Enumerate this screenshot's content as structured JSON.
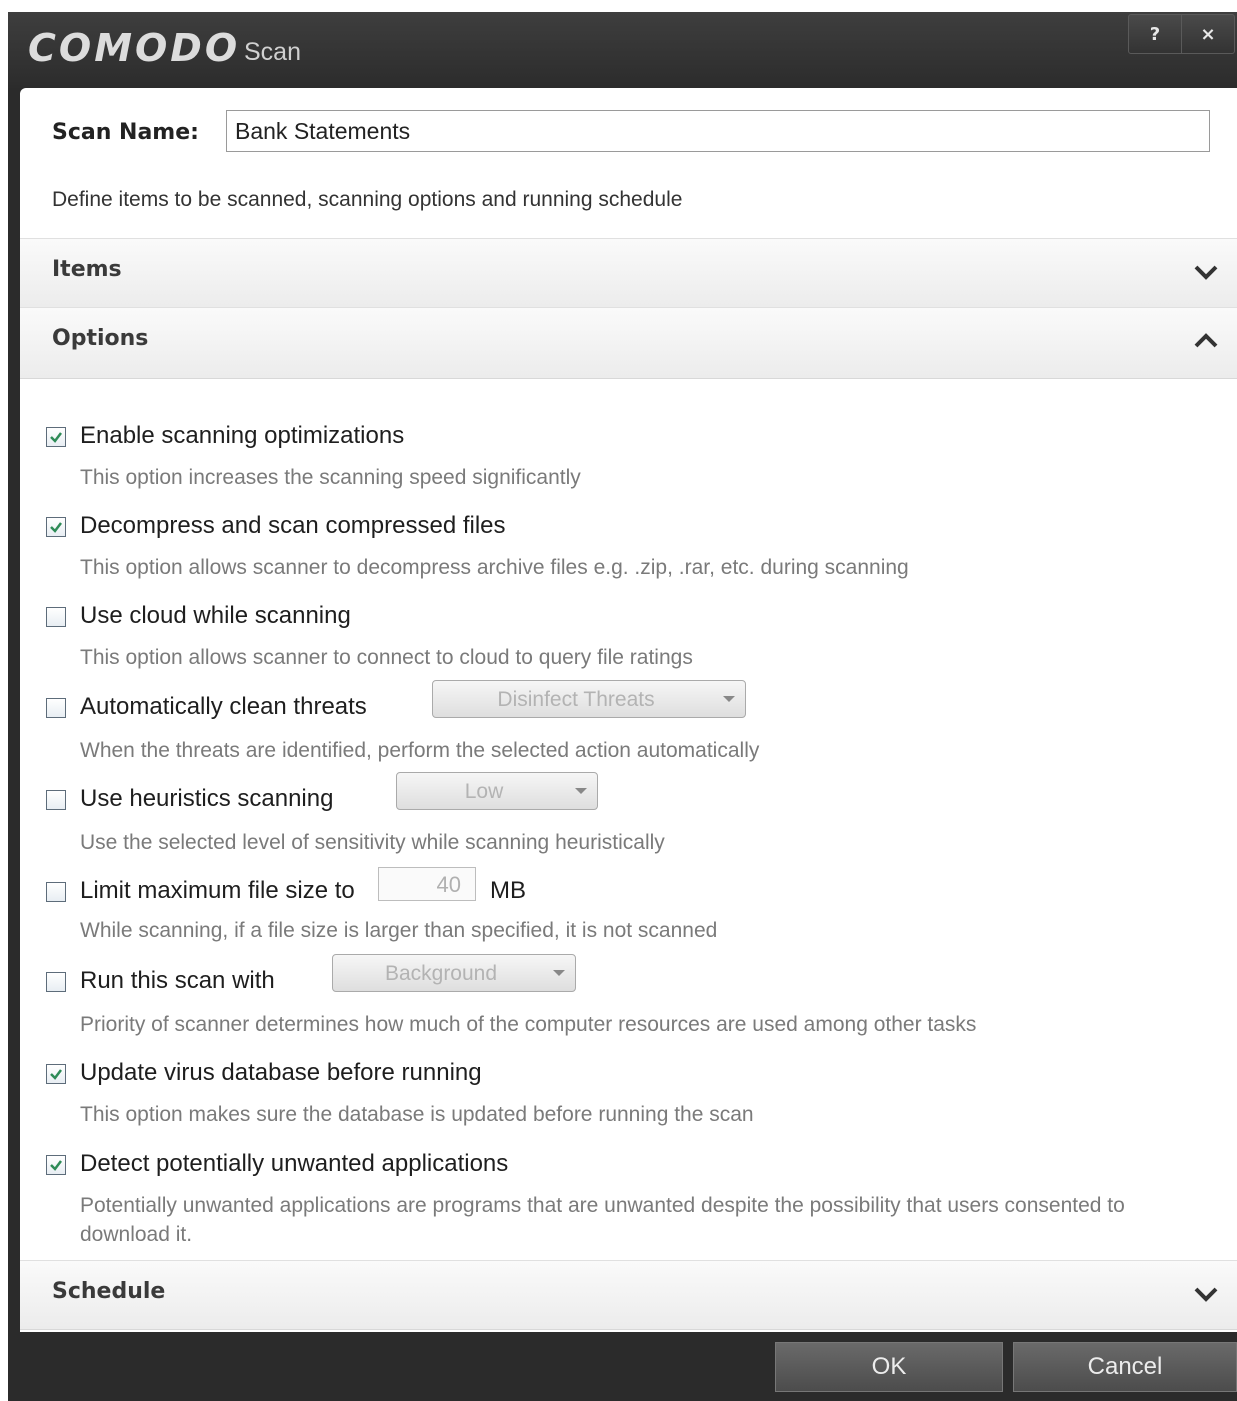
{
  "window": {
    "brand": "COMODO",
    "title": "Scan",
    "help_label": "?",
    "close_label": "×"
  },
  "scan_name": {
    "label": "Scan Name:",
    "value": "Bank Statements"
  },
  "intro": "Define items to be scanned, scanning options and running schedule",
  "sections": {
    "items": {
      "title": "Items",
      "state": "collapsed"
    },
    "options": {
      "title": "Options",
      "state": "expanded"
    },
    "schedule": {
      "title": "Schedule",
      "state": "collapsed"
    }
  },
  "options": [
    {
      "label": "Enable scanning optimizations",
      "checked": true,
      "description": "This option increases the scanning speed significantly"
    },
    {
      "label": "Decompress and scan compressed files",
      "checked": true,
      "description": "This option allows scanner to decompress archive files e.g. .zip, .rar, etc. during scanning"
    },
    {
      "label": "Use cloud while scanning",
      "checked": false,
      "description": "This option allows scanner to connect to cloud to query file ratings"
    },
    {
      "label": "Automatically clean threats",
      "checked": false,
      "description": "When the threats are identified, perform the selected action automatically",
      "select_value": "Disinfect Threats"
    },
    {
      "label": "Use heuristics scanning",
      "checked": false,
      "description": "Use the selected level of sensitivity while scanning heuristically",
      "select_value": "Low"
    },
    {
      "label": "Limit maximum file size to",
      "checked": false,
      "description": "While scanning, if a file size is larger than specified, it is not scanned",
      "number_value": "40",
      "unit": "MB"
    },
    {
      "label": "Run this scan with",
      "checked": false,
      "description": "Priority of scanner determines how much of the computer resources are used among other tasks",
      "select_value": "Background"
    },
    {
      "label": "Update virus database before running",
      "checked": true,
      "description": "This option makes sure the database is updated before running the scan"
    },
    {
      "label": "Detect potentially unwanted applications",
      "checked": true,
      "description": "Potentially unwanted applications are programs that are unwanted despite the possibility that users consented to download it."
    }
  ],
  "buttons": {
    "ok": "OK",
    "cancel": "Cancel"
  },
  "colors": {
    "checkmark": "#2e8b57",
    "chrome": "#2b2b2b"
  }
}
